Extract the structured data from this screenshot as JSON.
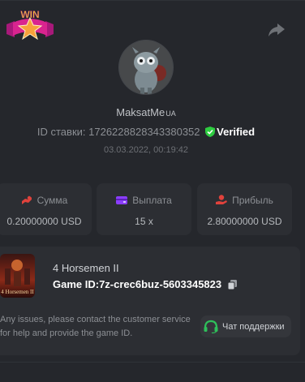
{
  "badge": {
    "text": "WIN"
  },
  "user": {
    "name": "MaksatMe",
    "name_suffix": "UA"
  },
  "bet": {
    "id_label": "ID ставки:",
    "id_value": "1726228828343380352",
    "verified_label": "Verified",
    "date": "03.03.2022, 00:19:42"
  },
  "stats": [
    {
      "icon": "coins-icon",
      "label": "Сумма",
      "value": "0.20000000 USD"
    },
    {
      "icon": "wallet-icon",
      "label": "Выплата",
      "value": "15 x"
    },
    {
      "icon": "profit-hand-icon",
      "label": "Прибыль",
      "value": "2.80000000 USD"
    }
  ],
  "game": {
    "thumb_label": "4 Horsemen II",
    "name": "4 Horsemen II",
    "id_label": "Game ID:",
    "id_value": "7z-crec6buz-5603345823"
  },
  "support": {
    "note": "Any issues, please contact the customer service for help and provide the game ID.",
    "button_label": "Чат поддержки"
  },
  "colors": {
    "background": "#25272c",
    "card": "#2c2e33",
    "verified_green": "#2ecc40",
    "stat_red": "#e0423c",
    "stat_purple": "#8b3dff",
    "headset_green": "#2ec05a"
  }
}
